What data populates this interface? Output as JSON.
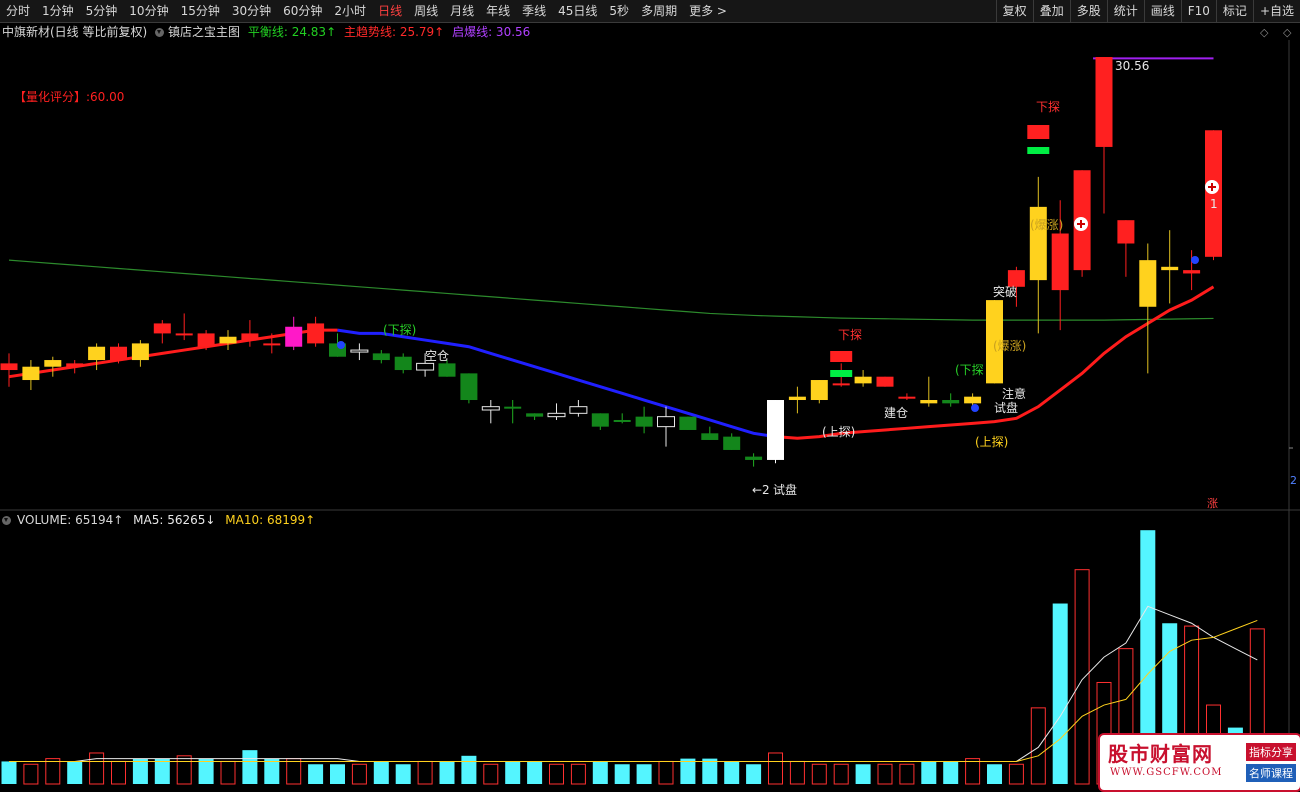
{
  "toolbar": {
    "periods": [
      "分时",
      "1分钟",
      "5分钟",
      "10分钟",
      "15分钟",
      "30分钟",
      "60分钟",
      "2小时",
      "日线",
      "周线",
      "月线",
      "年线",
      "季线",
      "45日线",
      "5秒",
      "多周期",
      "更多 >"
    ],
    "active_period": "日线",
    "tools": [
      "复权",
      "叠加",
      "多股",
      "统计",
      "画线",
      "F10",
      "标记",
      "+自选"
    ]
  },
  "main_legend": {
    "title": "中旗新材(日线 等比前复权)",
    "indicator": "镇店之宝主图",
    "balance_line": "平衡线: 24.83↑",
    "main_trend": "主趋势线: 25.79↑",
    "breakout_line": "启爆线: 30.56"
  },
  "score_label": "【量化评分】:60.00",
  "volume_legend": {
    "volume": "VOLUME: 65194↑",
    "ma5": "MA5: 56265↓",
    "ma10": "MA10: 68199↑"
  },
  "colors": {
    "up": "#ff2020",
    "down": "#13861b",
    "yellow": "#ffd21e",
    "magenta": "#ff19c8",
    "white": "#ffffff",
    "trend_red": "#ff1c1c",
    "trend_blue": "#2020ff",
    "balance": "#2c8a2c",
    "breakout": "#a020f0",
    "vol_cyan": "#54f5ff",
    "vol_red": "#ff3030"
  },
  "annotations": {
    "max_price": "30.56",
    "l_kongcang": "空仓",
    "l_xiatan1": "(下探)",
    "l_xiatan2": "下探",
    "l_xiatan3": "(下探",
    "l_xiatan4": "下探",
    "l_shangtan1": "(上探)",
    "l_shangtan2": "(上探)",
    "l_jiancang": "建仓",
    "l_shipan1": "试盘",
    "l_shipan2": "试盘",
    "l_zhuyi": "注意",
    "l_baozhang1": "(爆涨)",
    "l_baozhang2": "(爆涨)",
    "l_tupo": "突破",
    "l_last_marker": "1",
    "l_zhang": "涨",
    "l_right_edge": "2",
    "l_left_arrow": "←2"
  },
  "chart_data": {
    "type": "candlestick",
    "title": "中旗新材(日线 等比前复权)",
    "max_label": 30.56,
    "candles": [
      {
        "o": 21.2,
        "h": 21.7,
        "l": 20.7,
        "c": 21.4,
        "color": "red"
      },
      {
        "o": 20.9,
        "h": 21.5,
        "l": 20.6,
        "c": 21.3,
        "color": "yellow"
      },
      {
        "o": 21.3,
        "h": 21.6,
        "l": 21.0,
        "c": 21.5,
        "color": "yellow"
      },
      {
        "o": 21.3,
        "h": 21.5,
        "l": 21.1,
        "c": 21.4,
        "color": "red"
      },
      {
        "o": 21.5,
        "h": 22.0,
        "l": 21.2,
        "c": 21.9,
        "color": "yellow"
      },
      {
        "o": 21.5,
        "h": 22.0,
        "l": 21.4,
        "c": 21.9,
        "color": "red"
      },
      {
        "o": 21.5,
        "h": 22.1,
        "l": 21.3,
        "c": 22.0,
        "color": "yellow"
      },
      {
        "o": 22.3,
        "h": 22.7,
        "l": 22.0,
        "c": 22.6,
        "color": "red"
      },
      {
        "o": 22.3,
        "h": 22.9,
        "l": 22.1,
        "c": 22.3,
        "color": "red"
      },
      {
        "o": 21.9,
        "h": 22.4,
        "l": 21.8,
        "c": 22.3,
        "color": "red"
      },
      {
        "o": 22.0,
        "h": 22.4,
        "l": 21.8,
        "c": 22.2,
        "color": "yellow"
      },
      {
        "o": 22.1,
        "h": 22.7,
        "l": 21.9,
        "c": 22.3,
        "color": "red"
      },
      {
        "o": 22.0,
        "h": 22.3,
        "l": 21.7,
        "c": 22.0,
        "color": "red"
      },
      {
        "o": 21.9,
        "h": 22.8,
        "l": 21.8,
        "c": 22.5,
        "color": "magenta"
      },
      {
        "o": 22.0,
        "h": 22.8,
        "l": 21.9,
        "c": 22.6,
        "color": "red"
      },
      {
        "o": 22.0,
        "h": 22.3,
        "l": 21.6,
        "c": 21.6,
        "color": "green"
      },
      {
        "o": 21.8,
        "h": 22.0,
        "l": 21.5,
        "c": 21.8,
        "color": "hollow"
      },
      {
        "o": 21.7,
        "h": 21.8,
        "l": 21.4,
        "c": 21.5,
        "color": "green"
      },
      {
        "o": 21.6,
        "h": 21.7,
        "l": 21.1,
        "c": 21.2,
        "color": "green"
      },
      {
        "o": 21.2,
        "h": 21.7,
        "l": 21.0,
        "c": 21.4,
        "color": "hollow"
      },
      {
        "o": 21.4,
        "h": 21.5,
        "l": 21.0,
        "c": 21.0,
        "color": "green"
      },
      {
        "o": 21.1,
        "h": 21.1,
        "l": 20.2,
        "c": 20.3,
        "color": "green"
      },
      {
        "o": 20.0,
        "h": 20.3,
        "l": 19.6,
        "c": 20.1,
        "color": "hollow"
      },
      {
        "o": 20.1,
        "h": 20.3,
        "l": 19.6,
        "c": 20.1,
        "color": "green"
      },
      {
        "o": 19.8,
        "h": 19.9,
        "l": 19.7,
        "c": 19.9,
        "color": "green"
      },
      {
        "o": 19.8,
        "h": 20.2,
        "l": 19.7,
        "c": 19.9,
        "color": "hollow"
      },
      {
        "o": 19.9,
        "h": 20.3,
        "l": 19.8,
        "c": 20.1,
        "color": "hollow"
      },
      {
        "o": 19.9,
        "h": 19.9,
        "l": 19.4,
        "c": 19.5,
        "color": "green"
      },
      {
        "o": 19.7,
        "h": 19.9,
        "l": 19.6,
        "c": 19.7,
        "color": "green"
      },
      {
        "o": 19.8,
        "h": 20.1,
        "l": 19.3,
        "c": 19.5,
        "color": "green"
      },
      {
        "o": 19.5,
        "h": 20.1,
        "l": 18.9,
        "c": 19.8,
        "color": "hollow"
      },
      {
        "o": 19.8,
        "h": 19.8,
        "l": 19.4,
        "c": 19.4,
        "color": "green"
      },
      {
        "o": 19.3,
        "h": 19.5,
        "l": 19.1,
        "c": 19.1,
        "color": "green"
      },
      {
        "o": 19.2,
        "h": 19.3,
        "l": 18.8,
        "c": 18.8,
        "color": "green"
      },
      {
        "o": 18.6,
        "h": 18.7,
        "l": 18.3,
        "c": 18.5,
        "color": "green"
      },
      {
        "o": 18.5,
        "h": 20.3,
        "l": 18.4,
        "c": 20.3,
        "color": "white"
      },
      {
        "o": 20.3,
        "h": 20.7,
        "l": 19.9,
        "c": 20.4,
        "color": "yellow"
      },
      {
        "o": 20.3,
        "h": 20.9,
        "l": 20.2,
        "c": 20.9,
        "color": "yellow"
      },
      {
        "o": 20.8,
        "h": 21.4,
        "l": 20.7,
        "c": 20.8,
        "color": "red"
      },
      {
        "o": 20.8,
        "h": 21.2,
        "l": 20.7,
        "c": 21.0,
        "color": "yellow"
      },
      {
        "o": 20.7,
        "h": 21.0,
        "l": 20.7,
        "c": 21.0,
        "color": "red"
      },
      {
        "o": 20.4,
        "h": 20.5,
        "l": 20.3,
        "c": 20.4,
        "color": "red"
      },
      {
        "o": 20.2,
        "h": 21.0,
        "l": 20.1,
        "c": 20.3,
        "color": "yellow"
      },
      {
        "o": 20.2,
        "h": 20.5,
        "l": 20.1,
        "c": 20.3,
        "color": "green"
      },
      {
        "o": 20.2,
        "h": 20.5,
        "l": 20.0,
        "c": 20.4,
        "color": "yellow"
      },
      {
        "o": 20.8,
        "h": 23.3,
        "l": 20.8,
        "c": 23.3,
        "color": "yellow"
      },
      {
        "o": 23.7,
        "h": 24.3,
        "l": 23.1,
        "c": 24.2,
        "color": "red"
      },
      {
        "o": 23.9,
        "h": 27.0,
        "l": 22.3,
        "c": 26.1,
        "color": "yellow"
      },
      {
        "o": 23.6,
        "h": 26.3,
        "l": 22.4,
        "c": 25.3,
        "color": "red"
      },
      {
        "o": 24.2,
        "h": 27.2,
        "l": 24.0,
        "c": 27.2,
        "color": "red"
      },
      {
        "o": 27.9,
        "h": 30.6,
        "l": 25.9,
        "c": 30.6,
        "color": "red"
      },
      {
        "o": 25.0,
        "h": 25.7,
        "l": 24.0,
        "c": 25.7,
        "color": "red"
      },
      {
        "o": 23.1,
        "h": 25.0,
        "l": 21.1,
        "c": 24.5,
        "color": "yellow"
      },
      {
        "o": 24.2,
        "h": 25.4,
        "l": 23.2,
        "c": 24.3,
        "color": "yellow"
      },
      {
        "o": 24.2,
        "h": 24.8,
        "l": 23.6,
        "c": 24.1,
        "color": "red"
      },
      {
        "o": 24.6,
        "h": 28.4,
        "l": 24.5,
        "c": 28.4,
        "color": "red"
      }
    ],
    "trend_line": [
      21.0,
      21.1,
      21.2,
      21.3,
      21.4,
      21.5,
      21.6,
      21.7,
      21.8,
      21.9,
      22.0,
      22.1,
      22.2,
      22.3,
      22.4,
      22.4,
      22.3,
      22.3,
      22.2,
      22.1,
      22.0,
      21.9,
      21.7,
      21.5,
      21.3,
      21.1,
      20.9,
      20.7,
      20.5,
      20.3,
      20.1,
      19.9,
      19.7,
      19.5,
      19.3,
      19.2,
      19.15,
      19.2,
      19.3,
      19.35,
      19.4,
      19.45,
      19.5,
      19.55,
      19.6,
      19.65,
      19.75,
      20.1,
      20.6,
      21.1,
      21.7,
      22.2,
      22.6,
      23.0,
      23.3,
      23.7
    ],
    "trend_blue_range": [
      15,
      35
    ],
    "balance_line": [
      24.5,
      24.45,
      24.4,
      24.35,
      24.3,
      24.25,
      24.2,
      24.15,
      24.1,
      24.05,
      24.0,
      23.95,
      23.9,
      23.85,
      23.8,
      23.75,
      23.7,
      23.65,
      23.6,
      23.55,
      23.5,
      23.45,
      23.4,
      23.35,
      23.3,
      23.25,
      23.2,
      23.15,
      23.1,
      23.05,
      23.0,
      22.95,
      22.9,
      22.87,
      22.84,
      22.82,
      22.8,
      22.78,
      22.76,
      22.75,
      22.74,
      22.73,
      22.72,
      22.71,
      22.7,
      22.7,
      22.7,
      22.7,
      22.7,
      22.7,
      22.7,
      22.71,
      22.72,
      22.73,
      22.74,
      22.75
    ],
    "volume": [
      {
        "v": 8,
        "color": "cyan"
      },
      {
        "v": 7,
        "color": "red"
      },
      {
        "v": 9,
        "color": "red"
      },
      {
        "v": 8,
        "color": "cyan"
      },
      {
        "v": 11,
        "color": "red"
      },
      {
        "v": 8,
        "color": "red"
      },
      {
        "v": 9,
        "color": "cyan"
      },
      {
        "v": 9,
        "color": "cyan"
      },
      {
        "v": 10,
        "color": "red"
      },
      {
        "v": 9,
        "color": "cyan"
      },
      {
        "v": 8,
        "color": "red"
      },
      {
        "v": 12,
        "color": "cyan"
      },
      {
        "v": 9,
        "color": "cyan"
      },
      {
        "v": 9,
        "color": "red"
      },
      {
        "v": 7,
        "color": "cyan"
      },
      {
        "v": 7,
        "color": "cyan"
      },
      {
        "v": 7,
        "color": "red"
      },
      {
        "v": 8,
        "color": "cyan"
      },
      {
        "v": 7,
        "color": "cyan"
      },
      {
        "v": 8,
        "color": "red"
      },
      {
        "v": 8,
        "color": "cyan"
      },
      {
        "v": 10,
        "color": "cyan"
      },
      {
        "v": 7,
        "color": "red"
      },
      {
        "v": 8,
        "color": "cyan"
      },
      {
        "v": 8,
        "color": "cyan"
      },
      {
        "v": 7,
        "color": "red"
      },
      {
        "v": 7,
        "color": "red"
      },
      {
        "v": 8,
        "color": "cyan"
      },
      {
        "v": 7,
        "color": "cyan"
      },
      {
        "v": 7,
        "color": "cyan"
      },
      {
        "v": 8,
        "color": "red"
      },
      {
        "v": 9,
        "color": "cyan"
      },
      {
        "v": 9,
        "color": "cyan"
      },
      {
        "v": 8,
        "color": "cyan"
      },
      {
        "v": 7,
        "color": "cyan"
      },
      {
        "v": 11,
        "color": "red"
      },
      {
        "v": 8,
        "color": "red"
      },
      {
        "v": 7,
        "color": "red"
      },
      {
        "v": 7,
        "color": "red"
      },
      {
        "v": 7,
        "color": "cyan"
      },
      {
        "v": 7,
        "color": "red"
      },
      {
        "v": 7,
        "color": "red"
      },
      {
        "v": 8,
        "color": "cyan"
      },
      {
        "v": 8,
        "color": "cyan"
      },
      {
        "v": 9,
        "color": "red"
      },
      {
        "v": 7,
        "color": "cyan"
      },
      {
        "v": 7,
        "color": "red"
      },
      {
        "v": 27,
        "color": "red"
      },
      {
        "v": 64,
        "color": "cyan"
      },
      {
        "v": 76,
        "color": "red"
      },
      {
        "v": 36,
        "color": "red"
      },
      {
        "v": 48,
        "color": "red"
      },
      {
        "v": 90,
        "color": "cyan"
      },
      {
        "v": 57,
        "color": "cyan"
      },
      {
        "v": 56,
        "color": "red"
      },
      {
        "v": 28,
        "color": "red"
      },
      {
        "v": 20,
        "color": "cyan"
      },
      {
        "v": 55,
        "color": "red"
      }
    ],
    "ma5": [
      8,
      8,
      8,
      8,
      9,
      9,
      9,
      9,
      9,
      9,
      9,
      9,
      9,
      9,
      9,
      9,
      8,
      8,
      8,
      8,
      8,
      8,
      8,
      8,
      8,
      8,
      8,
      8,
      8,
      8,
      8,
      8,
      8,
      8,
      8,
      8,
      8,
      8,
      8,
      8,
      8,
      8,
      8,
      8,
      8,
      8,
      8,
      13,
      24,
      37,
      45,
      50,
      63,
      60,
      57,
      52,
      48,
      44
    ],
    "ma10": [
      8,
      8,
      8,
      8,
      8,
      8,
      8,
      8,
      8,
      8,
      8,
      8,
      8,
      8,
      8,
      8,
      8,
      8,
      8,
      8,
      8,
      8,
      8,
      8,
      8,
      8,
      8,
      8,
      8,
      8,
      8,
      8,
      8,
      8,
      8,
      8,
      8,
      8,
      8,
      8,
      8,
      8,
      8,
      8,
      8,
      8,
      8,
      10,
      16,
      24,
      28,
      30,
      39,
      47,
      51,
      52,
      55,
      58
    ]
  },
  "logo": {
    "name": "股市财富网",
    "url": "WWW.GSCFW.COM",
    "tag1": "指标分享",
    "tag2": "名师课程"
  }
}
